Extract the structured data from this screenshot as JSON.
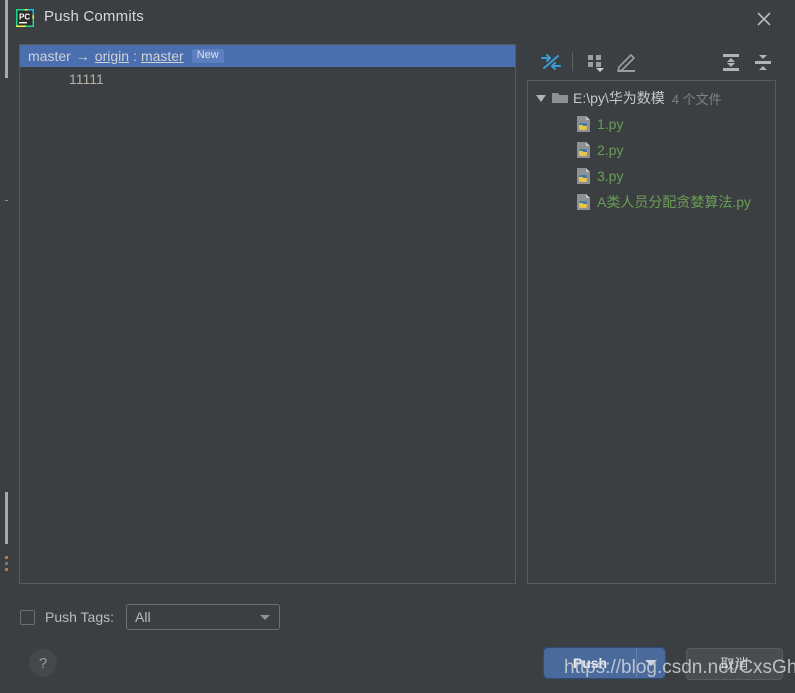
{
  "window": {
    "title": "Push Commits",
    "app_icon": "pycharm-icon",
    "close_icon": "close-icon"
  },
  "commits": {
    "branch_row": {
      "source": "master",
      "arrow": "→",
      "remote": "origin",
      "separator": ":",
      "target": "master",
      "badge": "New",
      "selected_color": "#4b6eaf"
    },
    "messages": [
      "11111"
    ]
  },
  "files_toolbar": {
    "icons": [
      {
        "name": "collapse-diff-icon",
        "label": "Compare"
      },
      {
        "name": "group-by-icon",
        "label": "Group By"
      },
      {
        "name": "edit-icon",
        "label": "Edit Source"
      },
      {
        "name": "expand-all-icon",
        "label": "Expand All"
      },
      {
        "name": "collapse-all-icon",
        "label": "Collapse All"
      }
    ]
  },
  "files_tree": {
    "root": {
      "path": "E:\\py\\华为数模",
      "count": "4 个文件",
      "expanded": true,
      "icon": "folder-icon"
    },
    "files": [
      {
        "name": "1.py",
        "icon": "python-file-icon"
      },
      {
        "name": "2.py",
        "icon": "python-file-icon"
      },
      {
        "name": "3.py",
        "icon": "python-file-icon"
      },
      {
        "name": "A类人员分配贪婪算法.py",
        "icon": "python-file-icon"
      }
    ]
  },
  "footer": {
    "push_tags_label": "Push Tags:",
    "push_tags_checked": false,
    "tags_value": "All",
    "tags_options": [
      "All"
    ],
    "help_label": "?",
    "push_label": "Push",
    "cancel_label": "取消"
  },
  "watermark": {
    "text": "https://blog.csdn.net/CxsGhost"
  },
  "colors": {
    "dialog_bg": "#3c3f41",
    "selection_blue": "#4b6eaf",
    "push_button": "#4a6a9b",
    "file_green": "#6a9e55",
    "accent_cyan": "#389fd6"
  }
}
